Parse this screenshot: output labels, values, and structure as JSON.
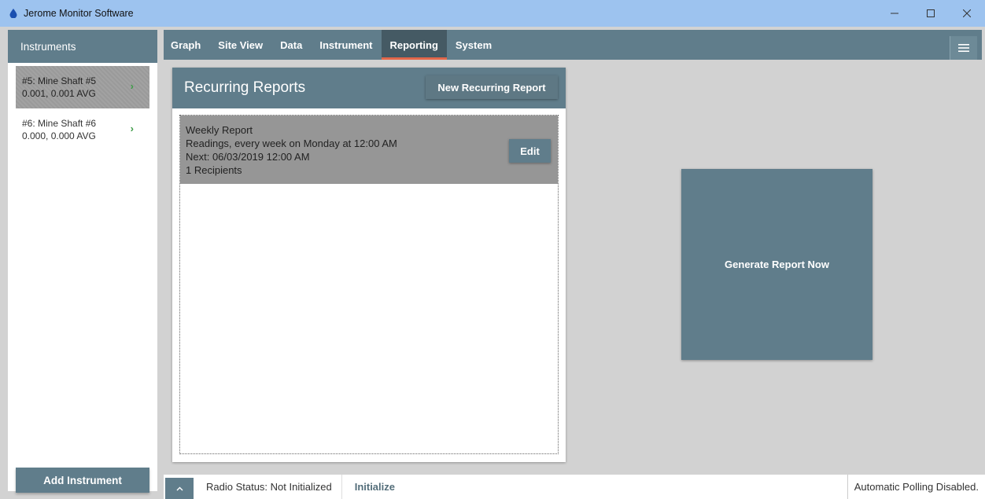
{
  "window": {
    "title": "Jerome Monitor Software",
    "icon": "water-drop-icon"
  },
  "sidebar": {
    "header": "Instruments",
    "items": [
      {
        "line1": "#5: Mine Shaft #5",
        "line2": "0.001, 0.001 AVG",
        "selected": true
      },
      {
        "line1": "#6: Mine Shaft #6",
        "line2": "0.000, 0.000 AVG",
        "selected": false
      }
    ],
    "add_button": "Add Instrument"
  },
  "tabs": [
    {
      "label": "Graph"
    },
    {
      "label": "Site View"
    },
    {
      "label": "Data"
    },
    {
      "label": "Instrument"
    },
    {
      "label": "Reporting",
      "active": true
    },
    {
      "label": "System"
    }
  ],
  "recurring_reports": {
    "title": "Recurring Reports",
    "new_button": "New Recurring Report",
    "items": [
      {
        "name": "Weekly Report",
        "schedule": "Readings, every week on Monday at 12:00 AM",
        "next": "Next: 06/03/2019 12:00 AM",
        "recipients": "1 Recipients",
        "edit_label": "Edit"
      }
    ]
  },
  "generate_button": "Generate Report Now",
  "status": {
    "radio_status": "Radio Status: Not Initialized",
    "initialize_link": "Initialize",
    "polling": "Automatic Polling Disabled."
  },
  "colors": {
    "accent": "#607d8b",
    "accent_dark": "#455a64",
    "titlebar": "#9dc3ef",
    "active_tab_underline": "#e2674a",
    "chevron": "#3e9b48"
  }
}
